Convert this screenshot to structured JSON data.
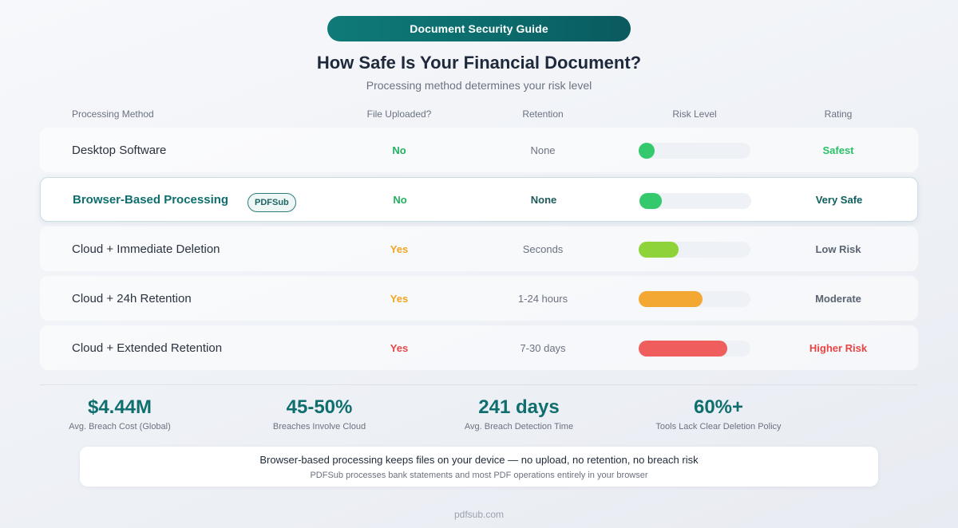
{
  "header": {
    "pill_label": "Document Security Guide",
    "title": "How Safe Is Your Financial Document?",
    "subtitle": "Processing method determines your risk level"
  },
  "columns": {
    "method": "Processing Method",
    "upload": "File Uploaded?",
    "retention": "Retention",
    "risk": "Risk Level",
    "rating": "Rating"
  },
  "rows": [
    {
      "method": "Desktop Software",
      "badge": "",
      "upload": "No",
      "upload_color": "#22b15f",
      "retention": "None",
      "risk_level": 0.14,
      "risk_color": "#34c96d",
      "rating": "Safest",
      "rating_color": "#2bbf66",
      "highlight": false
    },
    {
      "method": "Browser-Based Processing",
      "badge": "PDFSub",
      "upload": "No",
      "upload_color": "#22b15f",
      "retention": "None",
      "risk_level": 0.2,
      "risk_color": "#34c96d",
      "rating": "Very Safe",
      "rating_color": "#0f5e5e",
      "highlight": true
    },
    {
      "method": "Cloud + Immediate Deletion",
      "badge": "",
      "upload": "Yes",
      "upload_color": "#f2a521",
      "retention": "Seconds",
      "risk_level": 0.36,
      "risk_color": "#8fd33b",
      "rating": "Low Risk",
      "rating_color": "#5b6472",
      "highlight": false
    },
    {
      "method": "Cloud + 24h Retention",
      "badge": "",
      "upload": "Yes",
      "upload_color": "#f2a521",
      "retention": "1-24 hours",
      "risk_level": 0.57,
      "risk_color": "#f2a833",
      "rating": "Moderate",
      "rating_color": "#5b6472",
      "highlight": false
    },
    {
      "method": "Cloud + Extended Retention",
      "badge": "",
      "upload": "Yes",
      "upload_color": "#e74848",
      "retention": "7-30 days",
      "risk_level": 0.79,
      "risk_color": "#ef5d5d",
      "rating": "Higher Risk",
      "rating_color": "#e64545",
      "highlight": false
    }
  ],
  "stats": [
    {
      "value": "$4.44M",
      "label": "Avg. Breach Cost (Global)"
    },
    {
      "value": "45-50%",
      "label": "Breaches Involve Cloud"
    },
    {
      "value": "241 days",
      "label": "Avg. Breach Detection Time"
    },
    {
      "value": "60%+",
      "label": "Tools Lack Clear Deletion Policy"
    }
  ],
  "callout": {
    "main": "Browser-based processing keeps files on your device — no upload, no retention, no breach risk",
    "sub": "PDFSub processes bank statements and most PDF operations entirely in your browser"
  },
  "footer": "pdfsub.com",
  "colors": {
    "accent": "#0f6e6e",
    "pill_start": "#0f7a78",
    "pill_end": "#0a5a5f"
  }
}
